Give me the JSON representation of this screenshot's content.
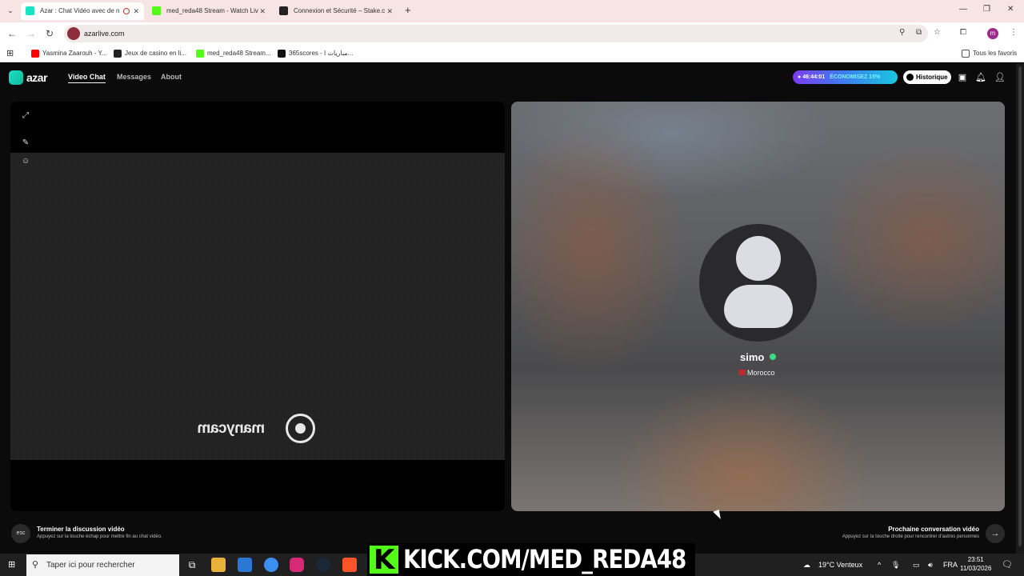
{
  "browser": {
    "tabs": [
      {
        "title": "Azar : Chat Vidéo avec de n",
        "active": true,
        "color": "#19e3c5"
      },
      {
        "title": "med_reda48 Stream - Watch Liv",
        "active": false,
        "color": "#53fc18"
      },
      {
        "title": "Connexion et Sécurité – Stake.c",
        "active": false,
        "color": "#222222"
      }
    ],
    "url": "azarlive.com",
    "profile_initial": "m",
    "bookmarks": [
      {
        "label": "Yasmina Zaarouh - Y...",
        "color": "#ff0000"
      },
      {
        "label": "Jeux de casino en li...",
        "color": "#222222"
      },
      {
        "label": "med_reda48 Stream...",
        "color": "#53fc18"
      },
      {
        "label": "365scores - مباريات ا...",
        "color": "#111111"
      }
    ],
    "all_bookmarks": "Tous les favoris"
  },
  "app": {
    "logo": "azar",
    "nav": {
      "video_chat": "Video Chat",
      "messages": "Messages",
      "about": "About"
    },
    "promo": {
      "timer": "46:44:01",
      "label": "ÉCONOMISEZ 15%"
    },
    "history": "Historique"
  },
  "left_panel": {
    "watermark": "manycam"
  },
  "right_panel": {
    "username": "simo",
    "country": "Morocco"
  },
  "bottom": {
    "esc_key": "esc",
    "end_title": "Terminer la discussion vidéo",
    "end_sub": "Appuyez sur la touche échap pour mettre fin au chat vidéo.",
    "next_title": "Prochaine conversation vidéo",
    "next_sub": "Appuyez sur la touche droite pour rencontrer d'autres personnes"
  },
  "overlay": {
    "kick_text": "KICK.COM/MED_REDA48"
  },
  "taskbar": {
    "search_placeholder": "Taper ici pour rechercher",
    "weather": "19°C Venteux",
    "lang": "FRA",
    "time": "23:51",
    "date": "11/03/2026"
  }
}
